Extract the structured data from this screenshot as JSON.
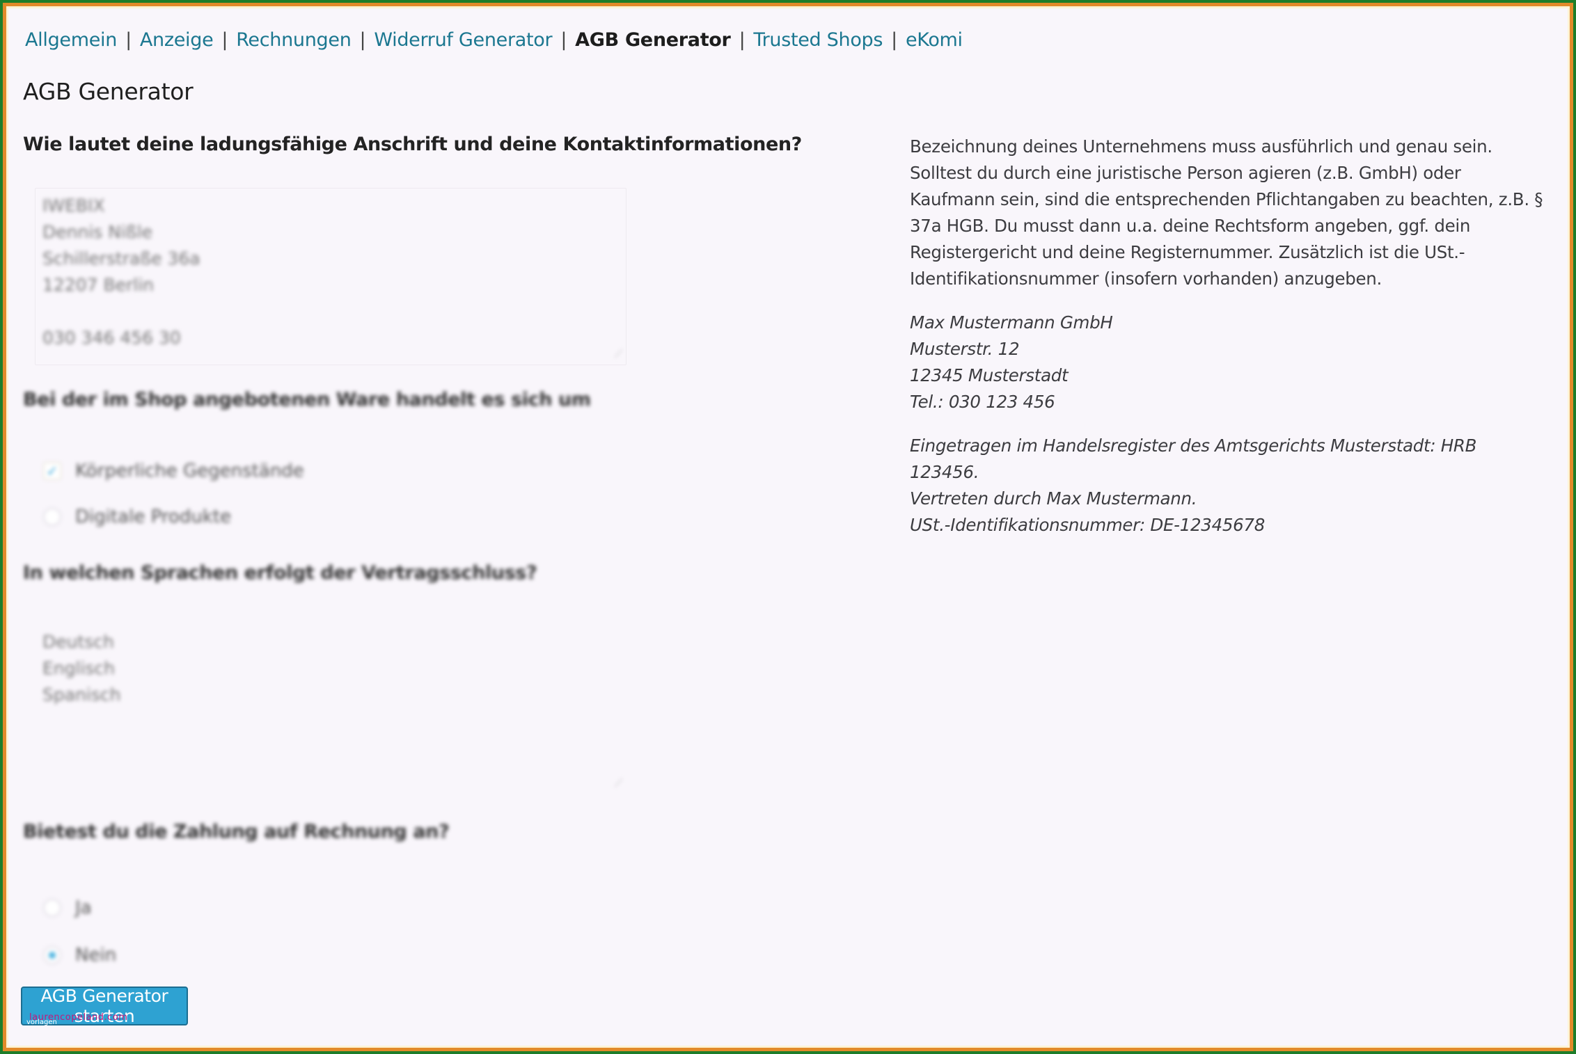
{
  "nav": {
    "items": [
      {
        "label": "Allgemein",
        "current": false
      },
      {
        "label": "Anzeige",
        "current": false
      },
      {
        "label": "Rechnungen",
        "current": false
      },
      {
        "label": "Widerruf Generator",
        "current": false
      },
      {
        "label": "AGB Generator",
        "current": true
      },
      {
        "label": "Trusted Shops",
        "current": false
      },
      {
        "label": "eKomi",
        "current": false
      }
    ],
    "separator": "|"
  },
  "page": {
    "title": "AGB Generator"
  },
  "form": {
    "address_question": "Wie lautet deine ladungsfähige Anschrift und deine Kontaktinformationen?",
    "address_lines": [
      "IWEBIX",
      "Dennis Nißle",
      "Schillerstraße 36a",
      "12207 Berlin",
      "",
      "030 346 456 30"
    ],
    "goods_question": "Bei der im Shop angebotenen Ware handelt es sich um",
    "goods_options": [
      {
        "label": "Körperliche Gegenstände",
        "checked": true
      },
      {
        "label": "Digitale Produkte",
        "checked": false
      }
    ],
    "languages_question": "In welchen Sprachen erfolgt der Vertragsschluss?",
    "languages": [
      "Deutsch",
      "Englisch",
      "Spanisch"
    ],
    "invoice_question": "Bietest du die Zahlung auf Rechnung an?",
    "invoice_options": [
      {
        "label": "Ja",
        "checked": false
      },
      {
        "label": "Nein",
        "checked": true
      }
    ],
    "submit_label": "AGB Generator starten"
  },
  "info": {
    "paragraph": "Bezeichnung deines Unternehmens muss ausführlich und genau sein. Solltest du durch eine juristische Person agieren (z.B. GmbH) oder Kaufmann sein, sind die entsprechenden Pflichtangaben zu beachten, z.B. § 37a HGB. Du musst dann u.a. deine Rechtsform angeben, ggf. dein Registergericht und deine Registernummer. Zusätzlich ist die USt.-Identifikationsnummer (insofern vorhanden) anzugeben.",
    "example_address": [
      "Max Mustermann GmbH",
      "Musterstr. 12",
      "12345 Musterstadt",
      "Tel.: 030 123 456"
    ],
    "example_register": [
      "Eingetragen im Handelsregister des Amtsgerichts Musterstadt: HRB 123456.",
      "Vertreten durch Max Mustermann.",
      "USt.-Identifikationsnummer: DE-12345678"
    ]
  },
  "watermark": {
    "site": "laurencopeland.com",
    "tag": "vorlagen"
  },
  "colors": {
    "link": "#1b7790",
    "button": "#2ea2d2",
    "frame_outer": "#1e7d2a",
    "frame_inner": "#e28a2a",
    "background": "#f9f6fb"
  }
}
